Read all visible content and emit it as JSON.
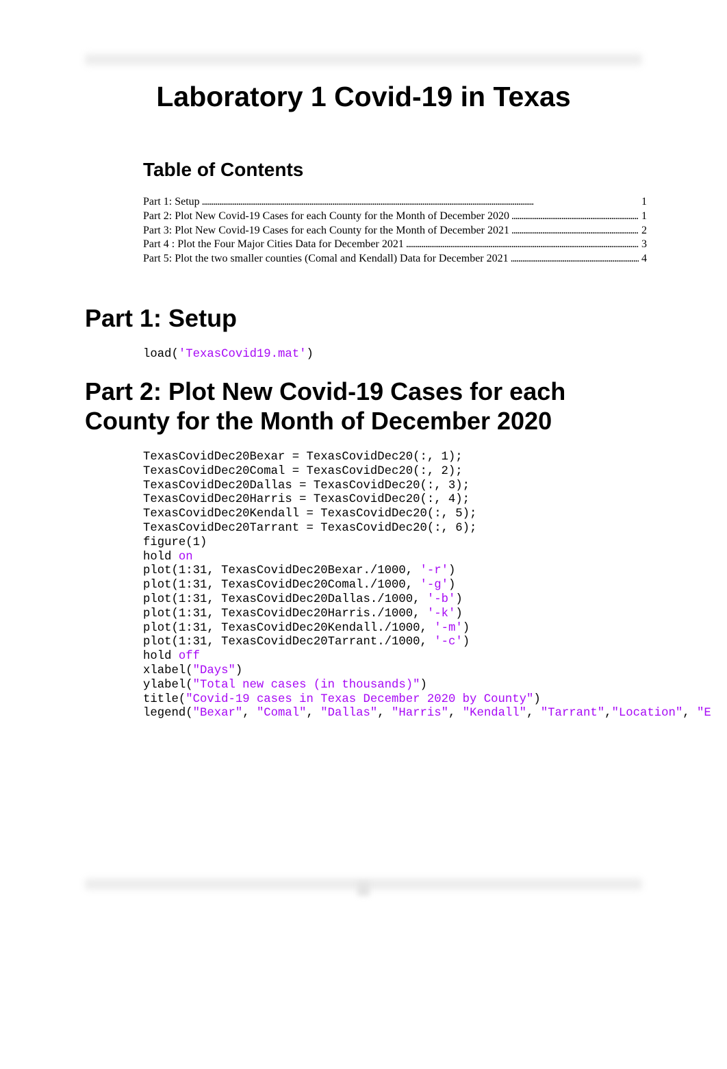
{
  "document": {
    "title": "Laboratory 1 Covid-19 in Texas",
    "colors": {
      "text": "#000000",
      "string_keyword": "#a709f5",
      "blurred_bar": "#ececec"
    },
    "toc": {
      "heading": "Table of Contents",
      "entries": [
        {
          "label": "Part 1: Setup",
          "page": "1"
        },
        {
          "label": "Part 2: Plot New Covid-19 Cases for each County for the Month of December 2020",
          "page": "1"
        },
        {
          "label": "Part 3: Plot New Covid-19 Cases for each County for the Month of December 2021",
          "page": "2"
        },
        {
          "label": "Part 4 : Plot the Four Major Cities Data for December 2021",
          "page": "3"
        },
        {
          "label": "Part 5: Plot the two smaller counties (Comal and Kendall) Data for December 2021",
          "page": "4"
        }
      ]
    },
    "sections": [
      {
        "heading": "Part 1: Setup",
        "code": [
          [
            {
              "t": "load("
            },
            {
              "t": "'TexasCovid19.mat'",
              "c": "str"
            },
            {
              "t": ")"
            }
          ]
        ]
      },
      {
        "heading": "Part 2: Plot New Covid-19 Cases for each County for the Month of December 2020",
        "code": [
          [
            {
              "t": "TexasCovidDec20Bexar = TexasCovidDec20(:, 1);"
            }
          ],
          [
            {
              "t": "TexasCovidDec20Comal = TexasCovidDec20(:, 2);"
            }
          ],
          [
            {
              "t": "TexasCovidDec20Dallas = TexasCovidDec20(:, 3);"
            }
          ],
          [
            {
              "t": "TexasCovidDec20Harris = TexasCovidDec20(:, 4);"
            }
          ],
          [
            {
              "t": "TexasCovidDec20Kendall = TexasCovidDec20(:, 5);"
            }
          ],
          [
            {
              "t": "TexasCovidDec20Tarrant = TexasCovidDec20(:, 6);"
            }
          ],
          [
            {
              "t": "figure(1)"
            }
          ],
          [
            {
              "t": "hold "
            },
            {
              "t": "on",
              "c": "kw"
            }
          ],
          [
            {
              "t": "plot(1:31, TexasCovidDec20Bexar./1000, "
            },
            {
              "t": "'-r'",
              "c": "str"
            },
            {
              "t": ")"
            }
          ],
          [
            {
              "t": "plot(1:31, TexasCovidDec20Comal./1000, "
            },
            {
              "t": "'-g'",
              "c": "str"
            },
            {
              "t": ")"
            }
          ],
          [
            {
              "t": "plot(1:31, TexasCovidDec20Dallas./1000, "
            },
            {
              "t": "'-b'",
              "c": "str"
            },
            {
              "t": ")"
            }
          ],
          [
            {
              "t": "plot(1:31, TexasCovidDec20Harris./1000, "
            },
            {
              "t": "'-k'",
              "c": "str"
            },
            {
              "t": ")"
            }
          ],
          [
            {
              "t": "plot(1:31, TexasCovidDec20Kendall./1000, "
            },
            {
              "t": "'-m'",
              "c": "str"
            },
            {
              "t": ")"
            }
          ],
          [
            {
              "t": "plot(1:31, TexasCovidDec20Tarrant./1000, "
            },
            {
              "t": "'-c'",
              "c": "str"
            },
            {
              "t": ")"
            }
          ],
          [
            {
              "t": "hold "
            },
            {
              "t": "off",
              "c": "kw"
            }
          ],
          [
            {
              "t": "xlabel("
            },
            {
              "t": "\"Days\"",
              "c": "str"
            },
            {
              "t": ")"
            }
          ],
          [
            {
              "t": "ylabel("
            },
            {
              "t": "\"Total new cases (in thousands)\"",
              "c": "str"
            },
            {
              "t": ")"
            }
          ],
          [
            {
              "t": "title("
            },
            {
              "t": "\"Covid-19 cases in Texas December 2020 by County\"",
              "c": "str"
            },
            {
              "t": ")"
            }
          ],
          [
            {
              "t": "legend("
            },
            {
              "t": "\"Bexar\"",
              "c": "str"
            },
            {
              "t": ", "
            },
            {
              "t": "\"Comal\"",
              "c": "str"
            },
            {
              "t": ", "
            },
            {
              "t": "\"Dallas\"",
              "c": "str"
            },
            {
              "t": ", "
            },
            {
              "t": "\"Harris\"",
              "c": "str"
            },
            {
              "t": ", "
            },
            {
              "t": "\"Kendall\"",
              "c": "str"
            },
            {
              "t": ", "
            },
            {
              "t": "\"Tarrant\"",
              "c": "str"
            },
            {
              "t": ","
            },
            {
              "t": "\"Location\"",
              "c": "str"
            },
            {
              "t": ", "
            },
            {
              "t": "\"E",
              "c": "str"
            }
          ]
        ]
      }
    ]
  }
}
